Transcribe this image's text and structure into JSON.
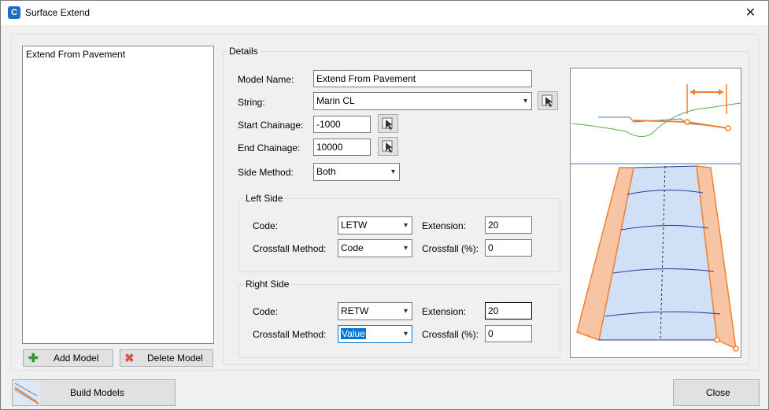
{
  "window": {
    "title": "Surface Extend",
    "app_icon_letter": "C",
    "close_glyph": "✕"
  },
  "model_list": {
    "items": [
      "Extend From Pavement"
    ]
  },
  "buttons": {
    "add_model": "Add Model",
    "delete_model": "Delete Model",
    "build_models": "Build Models",
    "close": "Close"
  },
  "details": {
    "legend": "Details",
    "model_name_label": "Model Name:",
    "model_name_value": "Extend From Pavement",
    "string_label": "String:",
    "string_value": "Marin CL",
    "start_chainage_label": "Start Chainage:",
    "start_chainage_value": "-1000",
    "end_chainage_label": "End Chainage:",
    "end_chainage_value": "10000",
    "side_method_label": "Side Method:",
    "side_method_value": "Both"
  },
  "left_side": {
    "legend": "Left Side",
    "code_label": "Code:",
    "code_value": "LETW",
    "crossfall_method_label": "Crossfall Method:",
    "crossfall_method_value": "Code",
    "extension_label": "Extension:",
    "extension_value": "20",
    "crossfall_label": "Crossfall (%):",
    "crossfall_value": "0"
  },
  "right_side": {
    "legend": "Right Side",
    "code_label": "Code:",
    "code_value": "RETW",
    "crossfall_method_label": "Crossfall Method:",
    "crossfall_method_value": "Value",
    "extension_label": "Extension:",
    "extension_value": "20",
    "crossfall_label": "Crossfall (%):",
    "crossfall_value": "0"
  },
  "colors": {
    "accent_orange": "#f08030",
    "road_blue": "#9fc1f0",
    "terrain_green": "#5aa64a",
    "selection": "#0078d7"
  }
}
